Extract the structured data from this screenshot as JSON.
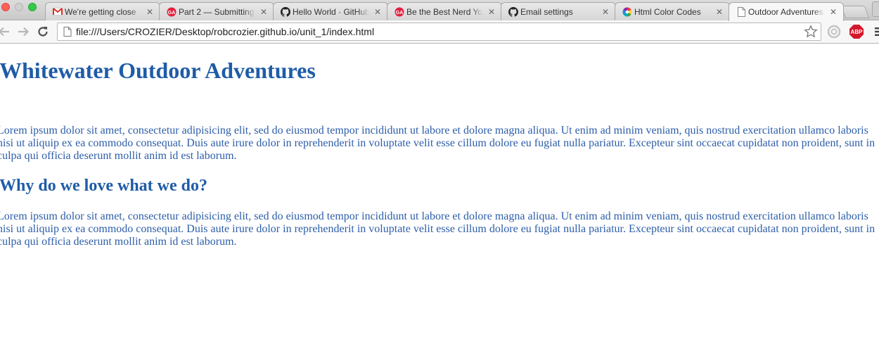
{
  "window": {
    "traffic_lights": [
      "close",
      "minimize",
      "zoom"
    ]
  },
  "tabs": [
    {
      "title": "We're getting close",
      "icon": "gmail-icon",
      "active": false
    },
    {
      "title": "Part 2 — Submitting",
      "icon": "ga-icon",
      "active": false
    },
    {
      "title": "Hello World · GitHub",
      "icon": "github-icon",
      "active": false
    },
    {
      "title": "Be the Best Nerd Yo",
      "icon": "ga-icon",
      "active": false
    },
    {
      "title": "Email settings",
      "icon": "github-icon",
      "active": false
    },
    {
      "title": "Html Color Codes",
      "icon": "color-wheel-icon",
      "active": false
    },
    {
      "title": "Outdoor Adventures",
      "icon": "page-icon",
      "active": true
    }
  ],
  "toolbar": {
    "url": "file:///Users/CROZIER/Desktop/robcrozier.github.io/unit_1/index.html",
    "abp_label": "ABP"
  },
  "page": {
    "heading": "Whitewater Outdoor Adventures",
    "paragraph1": "Lorem ipsum dolor sit amet, consectetur adipisicing elit, sed do eiusmod tempor incididunt ut labore et dolore magna aliqua. Ut enim ad minim veniam, quis nostrud exercitation ullamco laboris nisi ut aliquip ex ea commodo consequat. Duis aute irure dolor in reprehenderit in voluptate velit esse cillum dolore eu fugiat nulla pariatur. Excepteur sint occaecat cupidatat non proident, sunt in culpa qui officia deserunt mollit anim id est laborum.",
    "subheading": "Why do we love what we do?",
    "paragraph2": "Lorem ipsum dolor sit amet, consectetur adipisicing elit, sed do eiusmod tempor incididunt ut labore et dolore magna aliqua. Ut enim ad minim veniam, quis nostrud exercitation ullamco laboris nisi ut aliquip ex ea commodo consequat. Duis aute irure dolor in reprehenderit in voluptate velit esse cillum dolore eu fugiat nulla pariatur. Excepteur sint occaecat cupidatat non proident, sunt in culpa qui officia deserunt mollit anim id est laborum."
  },
  "colors": {
    "heading": "#1f5ca7",
    "body_text": "#2d5ea8"
  }
}
